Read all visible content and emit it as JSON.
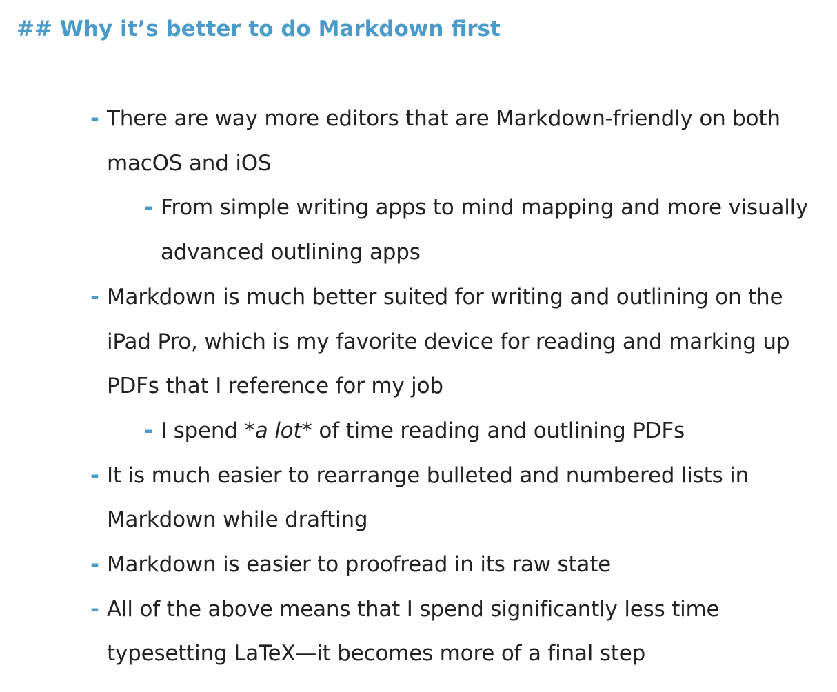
{
  "document": {
    "heading_marker": "##",
    "heading_text": "Why it’s better to do Markdown first"
  },
  "list": {
    "marker": "-",
    "items": [
      {
        "level": 1,
        "text": "There are way more editors that are Markdown-friendly on both macOS and iOS"
      },
      {
        "level": 2,
        "text": "From simple writing apps to mind mapping and more visually advanced outlining apps"
      },
      {
        "level": 1,
        "text": "Markdown is much better suited for writing and outlining on the iPad Pro, which is my favorite device for reading and marking up PDFs that I reference for my job"
      },
      {
        "level": 2,
        "text_before": "I spend ",
        "emphasis_open": "*",
        "emphasis_text": "a lot",
        "emphasis_close": "*",
        "text_after": " of time reading and outlining PDFs"
      },
      {
        "level": 1,
        "text": "It is much easier to rearrange bulleted and numbered lists in Markdown while drafting"
      },
      {
        "level": 1,
        "text": "Markdown is easier to proofread in its raw state"
      },
      {
        "level": 1,
        "text": "All of the above means that I spend significantly less time typesetting LaTeX—it becomes more of a final step"
      }
    ]
  },
  "colors": {
    "accent": "#4a9bc9",
    "text": "#222222",
    "background": "#ffffff"
  }
}
